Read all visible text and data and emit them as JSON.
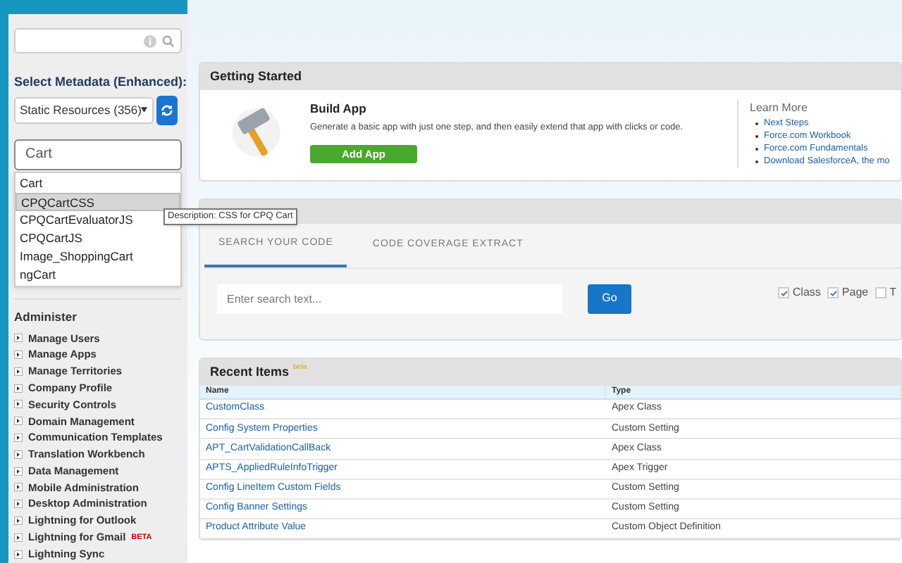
{
  "sidebar": {
    "metadata_label": "Select Metadata (Enhanced):",
    "metadata_select": {
      "value": "Static Resources (356)"
    },
    "filter_field": {
      "value": "Cart"
    },
    "suggestions": [
      {
        "label": "Cart",
        "selected": false
      },
      {
        "label": "CPQCartCSS",
        "selected": true
      },
      {
        "label": "CPQCartEvaluatorJS",
        "selected": false
      },
      {
        "label": "CPQCartJS",
        "selected": false
      },
      {
        "label": "Image_ShoppingCart",
        "selected": false
      },
      {
        "label": "ngCart",
        "selected": false
      }
    ],
    "tooltip": "Description: CSS for CPQ Cart",
    "section_title": "Administer",
    "items": [
      {
        "label": "Manage Users",
        "expanded": false
      },
      {
        "label": "Manage Apps",
        "expanded": false
      },
      {
        "label": "Manage Territories",
        "expanded": false
      },
      {
        "label": "Company Profile",
        "expanded": false
      },
      {
        "label": "Security Controls",
        "expanded": false
      },
      {
        "label": "Domain Management",
        "expanded": false
      },
      {
        "label": "Communication Templates",
        "expanded": false
      },
      {
        "label": "Translation Workbench",
        "expanded": false
      },
      {
        "label": "Data Management",
        "expanded": false
      },
      {
        "label": "Mobile Administration",
        "expanded": false
      },
      {
        "label": "Desktop Administration",
        "expanded": false
      },
      {
        "label": "Lightning for Outlook",
        "expanded": false
      },
      {
        "label": "Lightning for Gmail",
        "expanded": false,
        "badge": "BETA"
      },
      {
        "label": "Lightning Sync",
        "expanded": false
      }
    ]
  },
  "getting_started": {
    "title": "Getting Started",
    "heading": "Build App",
    "description": "Generate a basic app with just one step, and then easily extend that app with clicks or code.",
    "button": "Add App",
    "learn_more_title": "Learn More",
    "links": [
      "Next Steps",
      "Force.com Workbook",
      "Force.com Fundamentals",
      "Download SalesforceA, the mo"
    ]
  },
  "developer_utilities": {
    "tabs": [
      {
        "label": "SEARCH YOUR CODE",
        "selected": true
      },
      {
        "label": "CODE COVERAGE EXTRACT",
        "selected": false
      }
    ],
    "search": {
      "placeholder": "Enter search text..."
    },
    "button": "Go",
    "filters": [
      {
        "label": "Class",
        "checked": true
      },
      {
        "label": "Page",
        "checked": true
      },
      {
        "label": "T",
        "checked": false
      }
    ]
  },
  "recent_items": {
    "title": "Recent Items",
    "badge": "beta",
    "columns": [
      "Name",
      "Type"
    ],
    "rows": [
      [
        "CustomClass",
        "Apex Class"
      ],
      [
        "Config System Properties",
        "Custom Setting"
      ],
      [
        "APT_CartValidationCallBack",
        "Apex Class"
      ],
      [
        "APTS_AppliedRuleInfoTrigger",
        "Apex Trigger"
      ],
      [
        "Config LineItem Custom Fields",
        "Custom Setting"
      ],
      [
        "Config Banner Settings",
        "Custom Setting"
      ],
      [
        "Product Attribute Value",
        "Custom Object Definition"
      ]
    ]
  }
}
